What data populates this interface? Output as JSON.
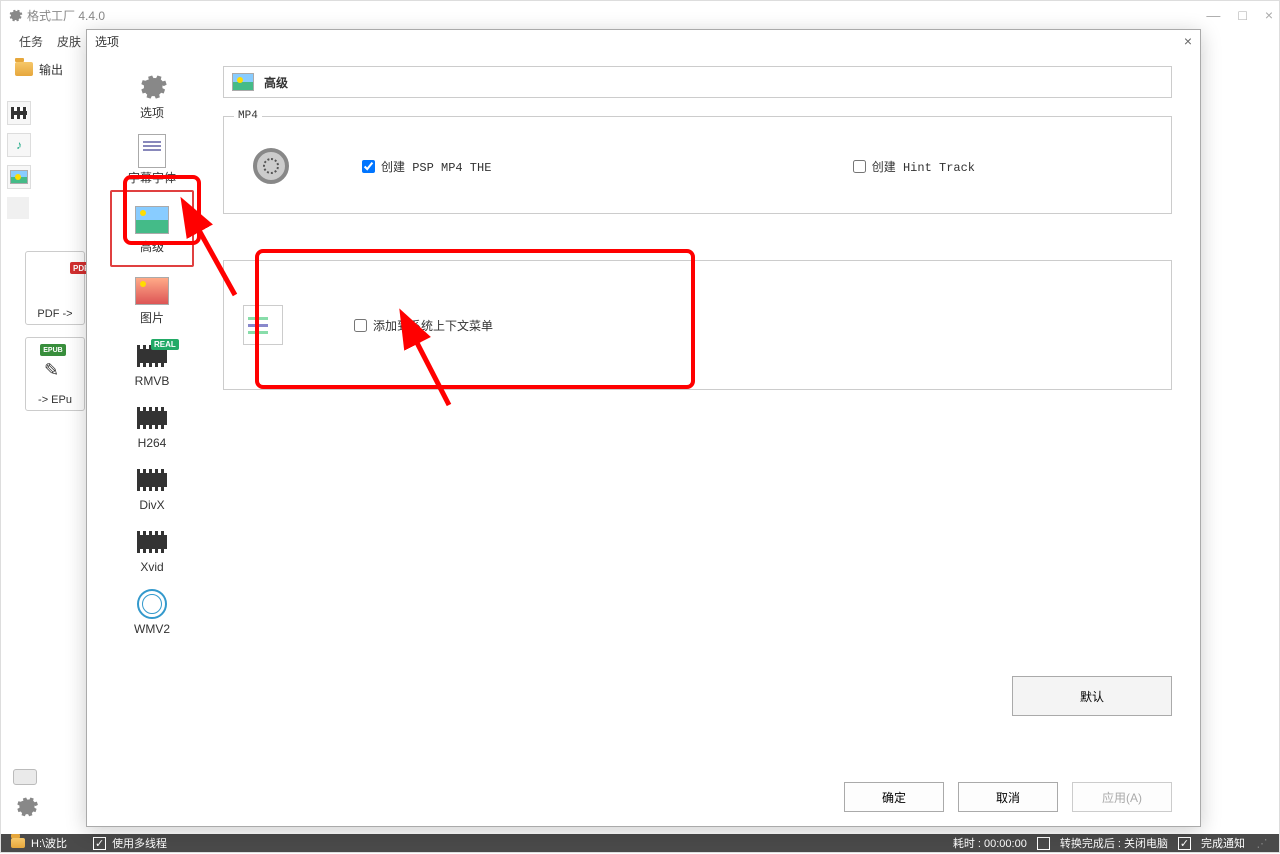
{
  "main_window": {
    "title": "格式工厂 4.4.0",
    "menu": {
      "tasks": "任务",
      "skin": "皮肤"
    },
    "toolbar": {
      "output": "输出"
    },
    "left_items": {
      "pdf_label": "PDF ->",
      "epub_label": "-> EPu",
      "pdf_badge": "PDF",
      "epub_badge": "EPUB"
    }
  },
  "statusbar": {
    "path": "H:\\波比",
    "multithread_label": "使用多线程",
    "multithread_checked": true,
    "time_label": "耗时 : 00:00:00",
    "after_convert_label": "转换完成后 : 关闭电脑",
    "after_convert_checked": false,
    "notify_label": "完成通知",
    "notify_checked": true
  },
  "dialog": {
    "title": "选项",
    "close": "×",
    "side": [
      {
        "key": "options",
        "label": "选项"
      },
      {
        "key": "subtitle_font",
        "label": "字幕字体"
      },
      {
        "key": "advanced",
        "label": "高级",
        "selected": true
      },
      {
        "key": "picture",
        "label": "图片"
      },
      {
        "key": "rmvb",
        "label": "RMVB"
      },
      {
        "key": "h264",
        "label": "H264"
      },
      {
        "key": "divx",
        "label": "DivX"
      },
      {
        "key": "xvid",
        "label": "Xvid"
      },
      {
        "key": "wmv2",
        "label": "WMV2"
      }
    ],
    "header_label": "高级",
    "mp4_group": {
      "title": "MP4",
      "psp_label": "创建 PSP MP4 THE",
      "psp_checked": true,
      "hint_label": "创建 Hint Track",
      "hint_checked": false
    },
    "context_menu_group": {
      "label": "添加到系统上下文菜单",
      "checked": false
    },
    "buttons": {
      "default": "默认",
      "ok": "确定",
      "cancel": "取消",
      "apply": "应用(A)"
    }
  }
}
